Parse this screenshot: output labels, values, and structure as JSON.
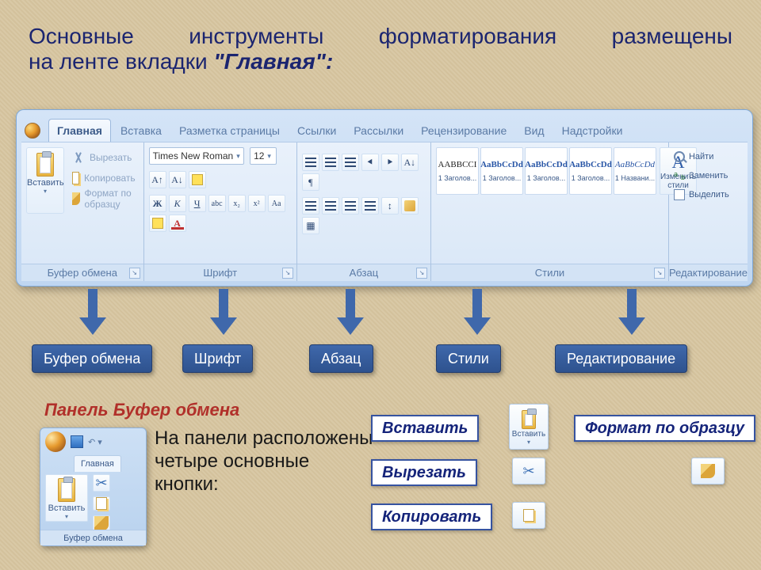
{
  "heading": {
    "line1": "Основные инструменты форматирования размещены",
    "line2_prefix": "на ленте вкладки ",
    "line2_accent": "\"Главная\":"
  },
  "ribbon": {
    "tabs": [
      "Главная",
      "Вставка",
      "Разметка страницы",
      "Ссылки",
      "Рассылки",
      "Рецензирование",
      "Вид",
      "Надстройки"
    ],
    "clipboard": {
      "paste": "Вставить",
      "cut": "Вырезать",
      "copy": "Копировать",
      "format_painter": "Формат по образцу",
      "label": "Буфер обмена"
    },
    "font": {
      "name": "Times New Roman",
      "size": "12",
      "label": "Шрифт"
    },
    "paragraph": {
      "label": "Абзац"
    },
    "styles": {
      "label": "Стили",
      "change": "Изменить стили",
      "tiles": [
        {
          "sample": "AABBCCI",
          "name": "1 Заголов..."
        },
        {
          "sample": "AaBbCcDd",
          "name": "1 Заголов..."
        },
        {
          "sample": "AaBbCcDd",
          "name": "1 Заголов..."
        },
        {
          "sample": "AaBbCcDd",
          "name": "1 Заголов..."
        },
        {
          "sample": "AaBbCcDd",
          "name": "1 Названи..."
        }
      ]
    },
    "editing": {
      "label": "Редактирование",
      "find": "Найти",
      "replace": "Заменить",
      "select": "Выделить"
    }
  },
  "callouts": [
    "Буфер обмена",
    "Шрифт",
    "Абзац",
    "Стили",
    "Редактирование"
  ],
  "bottom": {
    "panel_title": "Панель Буфер обмена",
    "desc": "На панели расположены четыре основные кнопки:",
    "mini": {
      "tab": "Главная",
      "paste": "Вставить",
      "label": "Буфер обмена"
    },
    "actions": {
      "paste": "Вставить",
      "cut": "Вырезать",
      "copy": "Копировать",
      "format": "Формат по образцу"
    }
  }
}
